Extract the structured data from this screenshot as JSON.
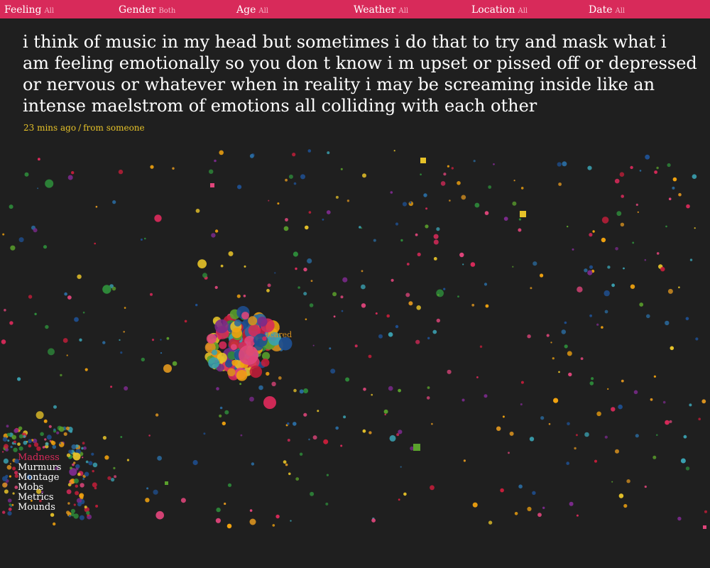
{
  "filters": [
    {
      "label": "Feeling",
      "value": "All"
    },
    {
      "label": "Gender",
      "value": "Both"
    },
    {
      "label": "Age",
      "value": "All"
    },
    {
      "label": "Weather",
      "value": "All"
    },
    {
      "label": "Location",
      "value": "All"
    },
    {
      "label": "Date",
      "value": "All"
    }
  ],
  "quote": {
    "text": "i think of music in my head but sometimes i do that to try and mask what i am feeling emotionally so you don t know i m upset or pissed off or depressed or nervous or whatever when in reality i may be screaming inside like an intense maelstrom of emotions all colliding with each other",
    "time": "23 mins ago",
    "separator": "/",
    "source": "from someone"
  },
  "cluster_label": "scared",
  "nav": {
    "items": [
      "Madness",
      "Murmurs",
      "Montage",
      "Mobs",
      "Metrics",
      "Mounds"
    ],
    "active": "Madness"
  },
  "colors": {
    "filter_bar": "#d82a5a",
    "background": "#1f1f1f",
    "meta_text": "#e6c229",
    "nav_active": "#d82a5a",
    "particles": [
      "#d82a5a",
      "#c41e3a",
      "#e6c229",
      "#f0a20f",
      "#2a6a9e",
      "#1f4f8f",
      "#2e8b3a",
      "#5aa02c",
      "#7a2a8a",
      "#e0457b",
      "#3aa0b0",
      "#d9921f"
    ]
  }
}
